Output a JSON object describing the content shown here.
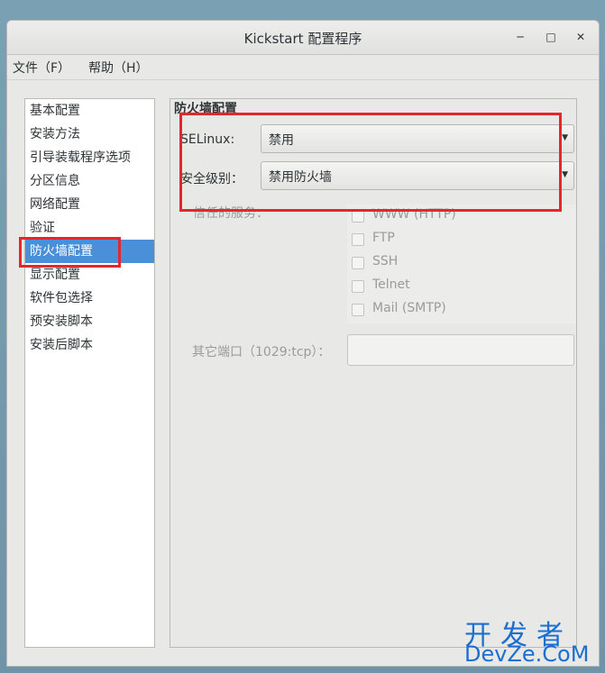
{
  "window": {
    "title": "Kickstart 配置程序"
  },
  "menubar": {
    "items": [
      "文件（F）",
      "帮助（H）"
    ]
  },
  "sidebar": {
    "items": [
      {
        "label": "基本配置"
      },
      {
        "label": "安装方法"
      },
      {
        "label": "引导装载程序选项"
      },
      {
        "label": "分区信息"
      },
      {
        "label": "网络配置"
      },
      {
        "label": "验证"
      },
      {
        "label": "防火墙配置",
        "active": true
      },
      {
        "label": "显示配置"
      },
      {
        "label": "软件包选择"
      },
      {
        "label": "预安装脚本"
      },
      {
        "label": "安装后脚本"
      }
    ]
  },
  "panel": {
    "title": "防火墙配置",
    "selinux_label": "SELinux:",
    "selinux_value": "禁用",
    "security_label": "安全级别：",
    "security_value": "禁用防火墙",
    "trusted_label": "信任的服务：",
    "services": [
      "WWW (HTTP)",
      "FTP",
      "SSH",
      "Telnet",
      "Mail (SMTP)"
    ],
    "other_ports_label": "其它端口（1029:tcp）："
  },
  "watermark": {
    "line1": "开发者",
    "line2": "DevZe.CoM"
  },
  "colors": {
    "selection": "#4a90d9",
    "highlight": "#e5262b",
    "watermark": "#1a6fd1"
  }
}
